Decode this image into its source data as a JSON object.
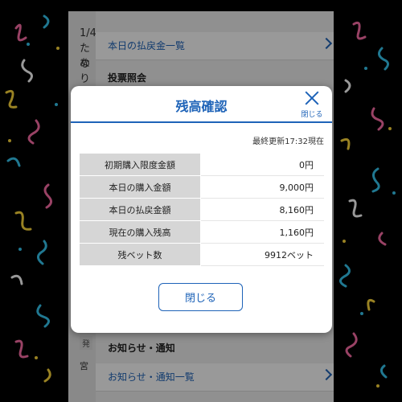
{
  "background_screen": {
    "left_text_lines": [
      "1/4",
      "ため",
      "なり"
    ],
    "payout_list_link": "本日の払戻金一覧",
    "vote_inquiry_section": "投票照会",
    "side_tag_1": "発",
    "side_tag_2": "宮",
    "notice_section": "お知らせ・通知",
    "notice_list_link": "お知らせ・通知一覧"
  },
  "modal": {
    "title": "残高確認",
    "close_x_label": "閉じる",
    "last_updated": "最終更新17:32現在",
    "rows": [
      {
        "label": "初期購入限度金額",
        "value": "0円"
      },
      {
        "label": "本日の購入金額",
        "value": "9,000円"
      },
      {
        "label": "本日の払戻金額",
        "value": "8,160円"
      },
      {
        "label": "現在の購入残高",
        "value": "1,160円"
      },
      {
        "label": "残ベット数",
        "value": "9912ベット"
      }
    ],
    "close_button": "閉じる"
  },
  "colors": {
    "accent": "#1e63b8",
    "confetti": [
      "#ff6fa8",
      "#36c9f2",
      "#ffd93b",
      "#ffffff"
    ]
  }
}
